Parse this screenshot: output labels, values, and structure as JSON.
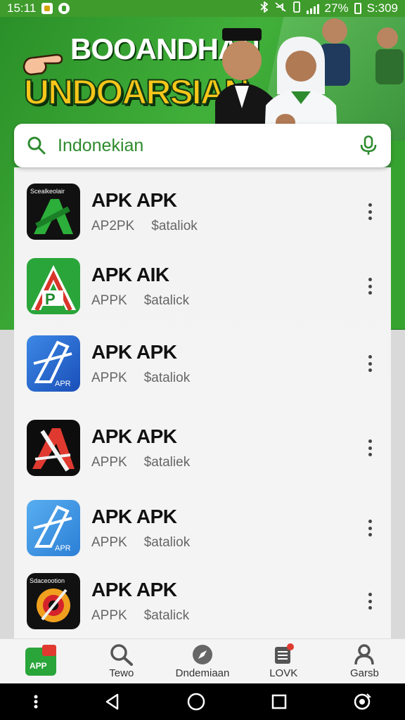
{
  "status_bar": {
    "time": "15:11",
    "battery": "27%",
    "clock_right": "S:309"
  },
  "banner": {
    "line1": "BOOANDHAN",
    "line2": "UNDOARSIAN"
  },
  "search": {
    "value": "Indonekian"
  },
  "apps": [
    {
      "name": "APK APK",
      "meta1": "AP2PK",
      "meta2": "$ataliok",
      "icon_label": "Scealkeolair",
      "icon": "green-a-logo-icon"
    },
    {
      "name": "APK AIK",
      "meta1": "APPK",
      "meta2": "$atalick",
      "icon_label": "",
      "icon": "green-p-logo-icon"
    },
    {
      "name": "APK APK",
      "meta1": "APPK",
      "meta2": "$ataliok",
      "icon_label": "APR",
      "icon": "blue-a-logo-icon"
    },
    {
      "name": "APK APK",
      "meta1": "APPK",
      "meta2": "$ataliek",
      "icon_label": "",
      "icon": "red-a-logo-icon"
    },
    {
      "name": "APK APK",
      "meta1": "APPK",
      "meta2": "$ataliok",
      "icon_label": "APR",
      "icon": "light-blue-a-logo-icon"
    },
    {
      "name": "APK APK",
      "meta1": "APPK",
      "meta2": "$atalick",
      "icon_label": "Sdaceootion",
      "icon": "orange-circle-logo-icon"
    }
  ],
  "bottom_nav": [
    {
      "label": "",
      "icon": "apk-app-icon"
    },
    {
      "label": "Tewo",
      "icon": "search-icon"
    },
    {
      "label": "Dndemiaan",
      "icon": "compass-icon"
    },
    {
      "label": "LOVK",
      "icon": "list-badge-icon"
    },
    {
      "label": "Garsb",
      "icon": "person-icon"
    }
  ],
  "app_badge_label": "APP",
  "colors": {
    "brand_green": "#2e8b2e",
    "banner_yellow": "#f6c61a"
  }
}
